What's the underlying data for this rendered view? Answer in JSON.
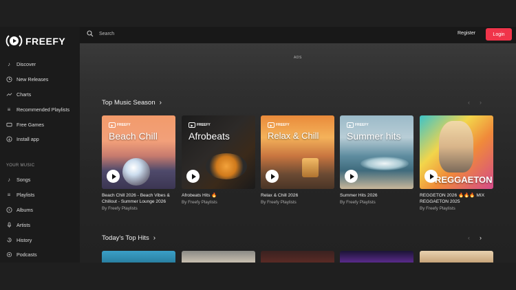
{
  "brand": {
    "name": "FREEFY"
  },
  "nav": {
    "main": [
      {
        "label": "Discover",
        "icon": "music-note-icon"
      },
      {
        "label": "New Releases",
        "icon": "clock-icon"
      },
      {
        "label": "Charts",
        "icon": "trend-icon"
      },
      {
        "label": "Recommended Playlists",
        "icon": "playlist-icon"
      },
      {
        "label": "Free Games",
        "icon": "gamepad-icon"
      },
      {
        "label": "Install app",
        "icon": "download-circle-icon"
      }
    ],
    "your_music_heading": "YOUR MUSIC",
    "your_music": [
      {
        "label": "Songs",
        "icon": "music-note-icon"
      },
      {
        "label": "Playlists",
        "icon": "playlist-icon"
      },
      {
        "label": "Albums",
        "icon": "disc-icon"
      },
      {
        "label": "Artists",
        "icon": "mic-icon"
      },
      {
        "label": "History",
        "icon": "history-icon"
      },
      {
        "label": "Podcasts",
        "icon": "podcast-icon"
      }
    ]
  },
  "header": {
    "search_placeholder": "Search",
    "register_label": "Register",
    "login_label": "Login"
  },
  "ads_label": "ADS",
  "sections": [
    {
      "title": "Top Music Season",
      "cards": [
        {
          "thumb_text": "Beach Chill",
          "title": "Beach Chill 2026 - Beach Vibes & Chillout - Summer Lounge 2026",
          "subtitle": "By Freefy Playlists"
        },
        {
          "thumb_text": "Afrobeats",
          "title": "Afrobeats Hits 🔥",
          "subtitle": "By Freefy Playlists"
        },
        {
          "thumb_text": "Relax & Chill",
          "title": "Relax & Chill 2026",
          "subtitle": "By Freefy Playlists"
        },
        {
          "thumb_text": "Summer hits",
          "title": "Summer Hits 2026",
          "subtitle": "By Freefy Playlists"
        },
        {
          "thumb_text": "REGGAETON",
          "title": "REGGETON 2026 🔥🔥🔥 MIX REGGAETON 2025",
          "subtitle": "By Freefy Playlists"
        }
      ]
    },
    {
      "title": "Today's Top Hits"
    }
  ],
  "thumb_brand": "FREEFY",
  "colors": {
    "accent": "#f0344a",
    "background": "#1b1b1b"
  }
}
